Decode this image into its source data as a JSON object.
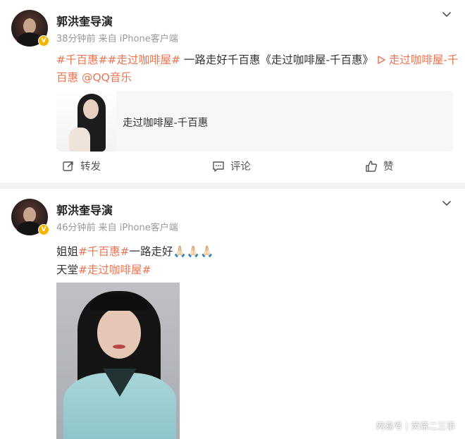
{
  "posts": [
    {
      "author": "郭洪奎导演",
      "verified_badge": "V",
      "meta": "38分钟前  来自 iPhone客户端",
      "line1": {
        "tag1": "#千百惠#",
        "tag2": "#走过咖啡屋#",
        "text": " 一路走好千百惠《走过咖啡屋-千百惠》",
        "music_link_icon": "play-triangle-icon",
        "music_link": " 走过咖啡屋-千"
      },
      "line2": {
        "music_link_cont": "百惠",
        "mention": " @QQ音乐"
      },
      "card": {
        "title": "走过咖啡屋-千百惠"
      },
      "actions": {
        "repost": "转发",
        "comment": "评论",
        "like": "赞"
      }
    },
    {
      "author": "郭洪奎导演",
      "verified_badge": "V",
      "meta": "46分钟前  来自 iPhone客户端",
      "line1": {
        "prefix": "姐姐",
        "tag": "#千百惠#",
        "suffix": "一路走好",
        "emoji": "🙏🏻🙏🏻🙏🏻"
      },
      "line2": {
        "prefix": "天堂",
        "tag": "#走过咖啡屋#"
      }
    }
  ],
  "watermark": {
    "brand": "网易号",
    "channel": "荧幕二三事"
  },
  "colors": {
    "accent": "#eb7350",
    "verified": "#f5b400",
    "divider": "#f2f2f2"
  }
}
